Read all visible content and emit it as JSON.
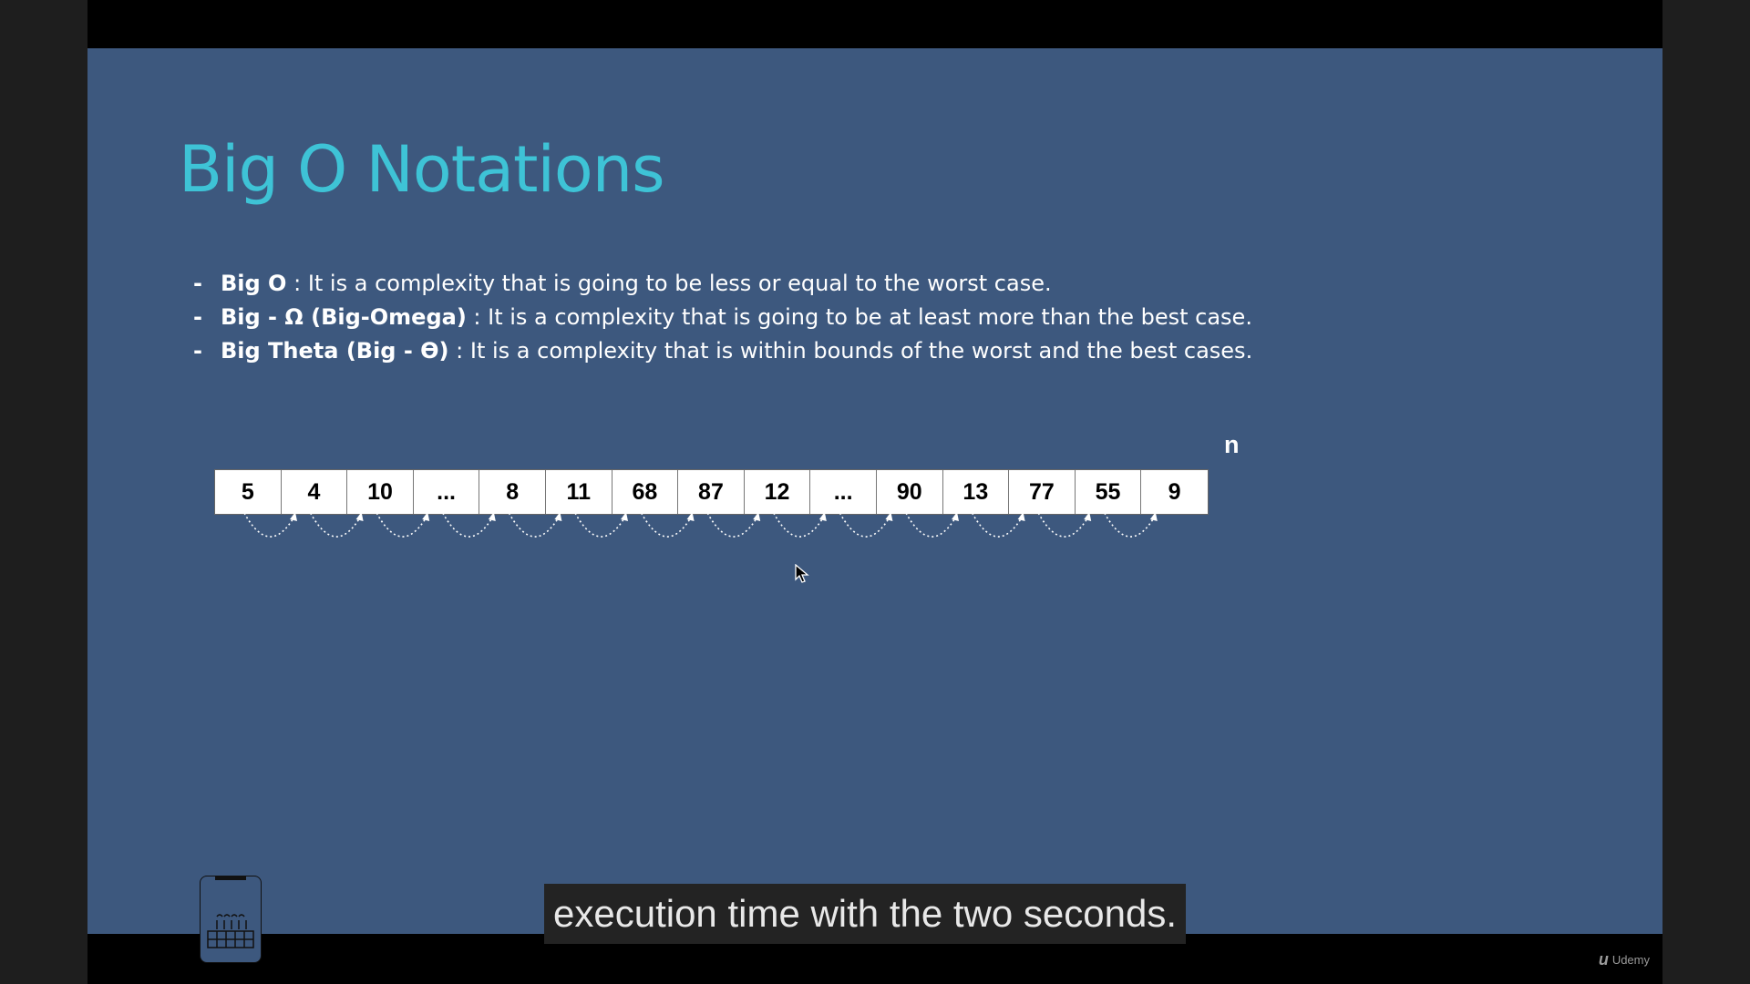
{
  "slide": {
    "title": "Big O Notations",
    "bullets": [
      {
        "term": "Big O",
        "text": " : It is a complexity that is going to be less or equal to the worst case."
      },
      {
        "term": "Big - Ω (Big-Omega)",
        "text": " : It is a complexity that is going to be at least more than the best case."
      },
      {
        "term": "Big Theta (Big - Ɵ)",
        "text": " : It is a complexity that is within bounds of the worst and the best cases."
      }
    ],
    "bullet_marker": "-",
    "n_label": "n",
    "array_values": [
      "5",
      "4",
      "10",
      "...",
      "8",
      "11",
      "68",
      "87",
      "12",
      "...",
      "90",
      "13",
      "77",
      "55",
      "9"
    ]
  },
  "caption": "execution time with the two seconds.",
  "brand": {
    "logo_text": "Udemy"
  },
  "colors": {
    "slide_bg": "#3d587e",
    "title": "#3ec3d6",
    "caption_bg": "#232323"
  },
  "icons": {
    "cursor": "mouse-pointer-icon",
    "device": "phone-keyboard-icon",
    "arc": "dotted-arc-arrow-icon"
  }
}
